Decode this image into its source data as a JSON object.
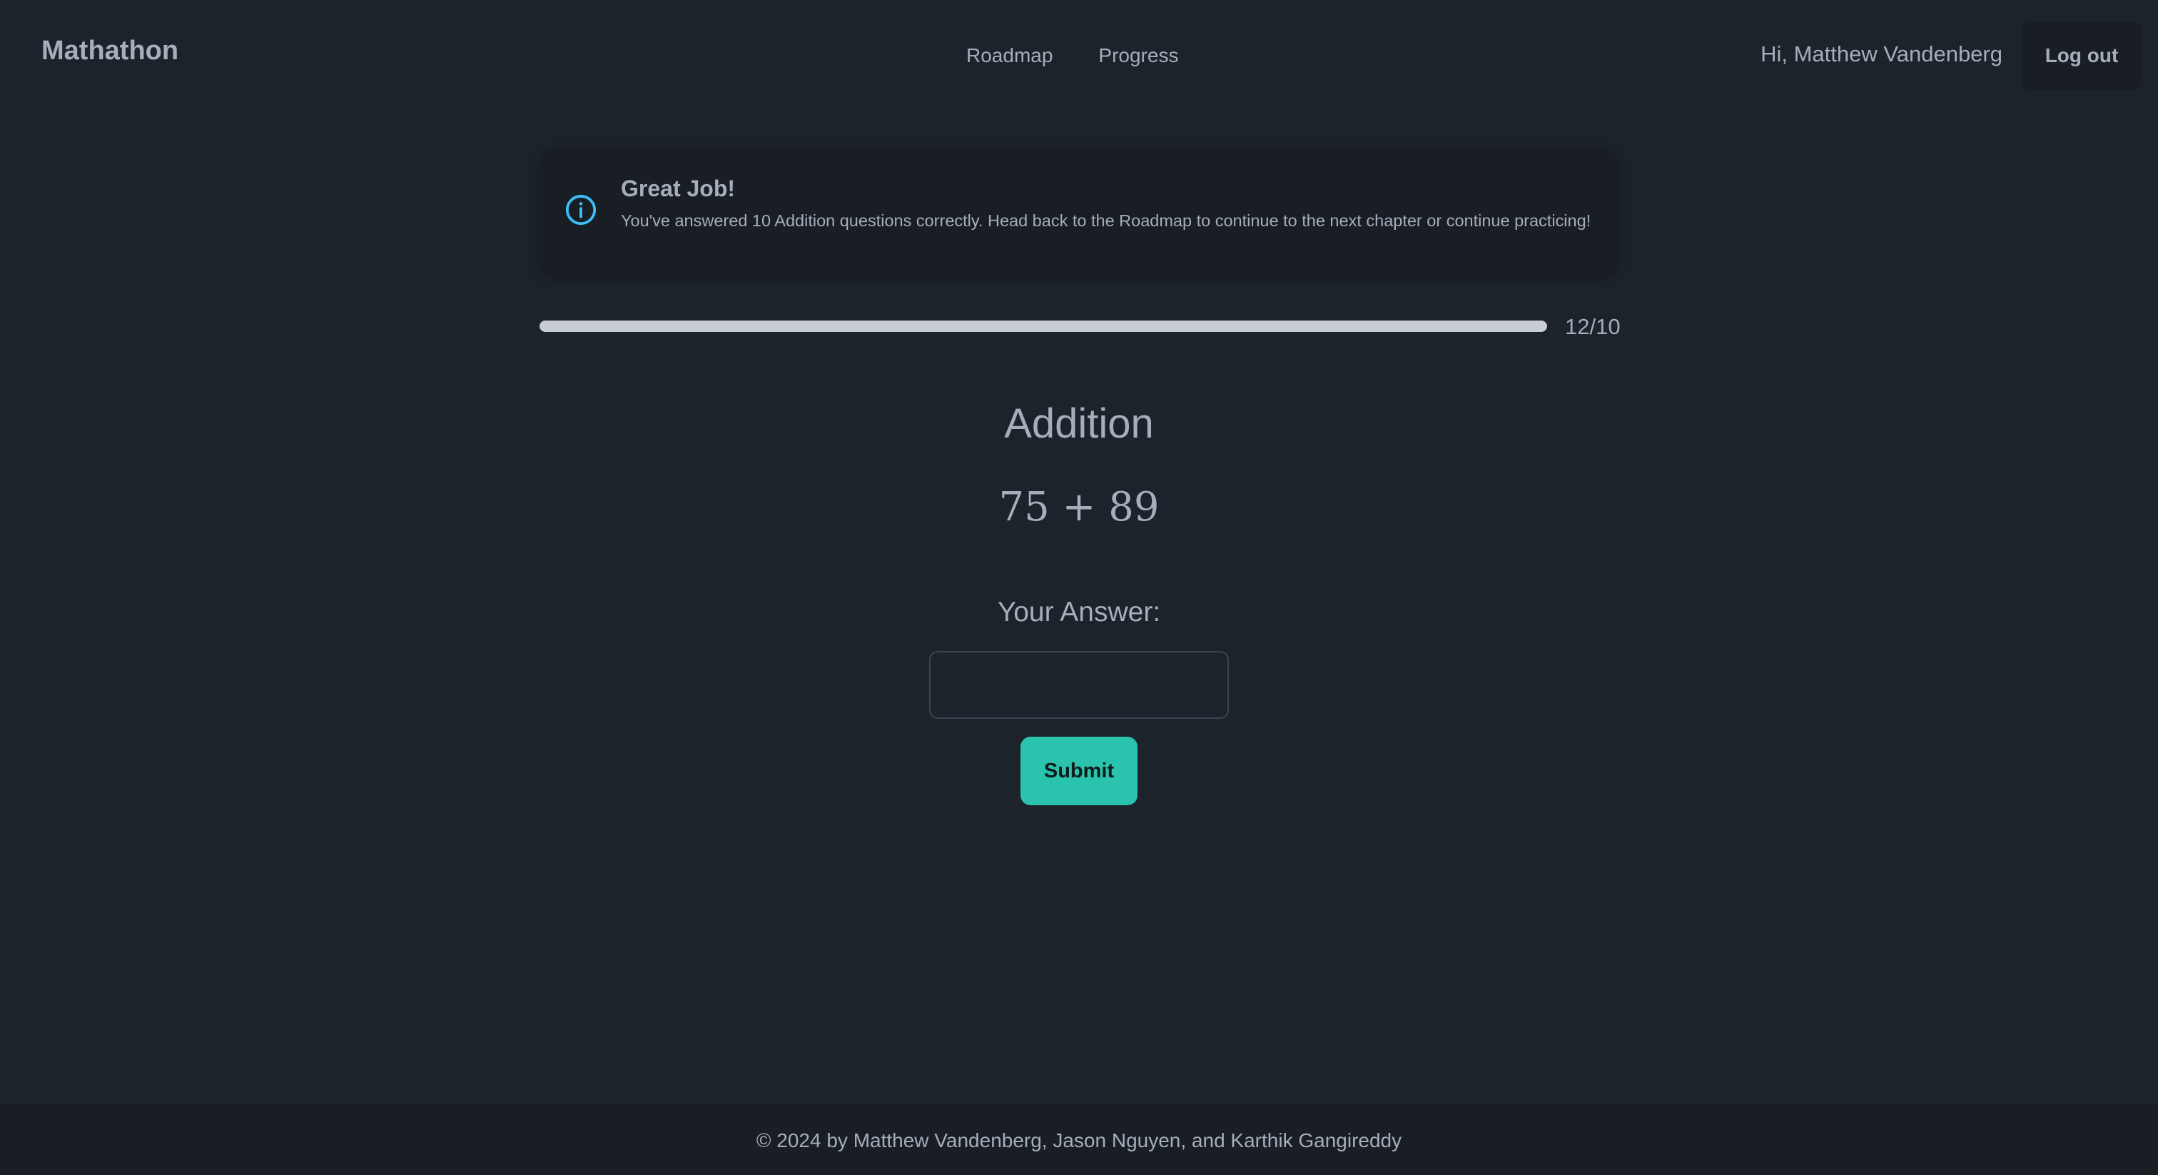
{
  "navbar": {
    "brand": "Mathathon",
    "links": [
      {
        "label": "Roadmap"
      },
      {
        "label": "Progress"
      }
    ],
    "greeting": "Hi, Matthew Vandenberg",
    "logout_label": "Log out"
  },
  "alert": {
    "icon": "info-circle-icon",
    "title": "Great Job!",
    "message": "You've answered 10 Addition questions correctly. Head back to the Roadmap to continue to the next chapter or continue practicing!"
  },
  "progress": {
    "label": "12/10",
    "fraction": 1.0
  },
  "question": {
    "chapter": "Addition",
    "problem": "75 + 89",
    "answer_label": "Your Answer:",
    "answer_value": "",
    "submit_label": "Submit"
  },
  "footer": {
    "text": "© 2024 by Matthew Vandenberg, Jason Nguyen, and Karthik Gangireddy"
  },
  "colors": {
    "background": "#1d232a",
    "surface": "#191e24",
    "text": "#a6adbb",
    "accent": "#2ac3ad",
    "info": "#3abff8"
  }
}
